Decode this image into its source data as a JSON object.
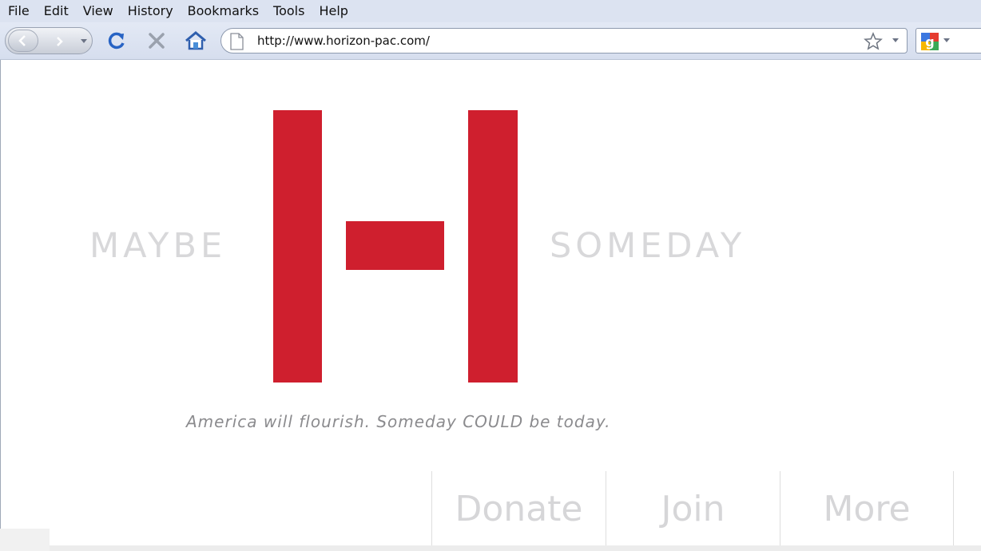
{
  "menubar": {
    "items": [
      {
        "label": "File"
      },
      {
        "label": "Edit"
      },
      {
        "label": "View"
      },
      {
        "label": "History"
      },
      {
        "label": "Bookmarks"
      },
      {
        "label": "Tools"
      },
      {
        "label": "Help"
      }
    ]
  },
  "toolbar": {
    "url": "http://www.horizon-pac.com/",
    "icons": [
      "back-icon",
      "forward-icon",
      "reload-icon",
      "stop-icon",
      "home-icon",
      "page-icon",
      "star-icon",
      "google-icon"
    ]
  },
  "hero": {
    "left_word": "MAYBE",
    "right_word": "SOMEDAY",
    "tagline": "America will flourish. Someday COULD be today."
  },
  "nav": {
    "donate": "Donate",
    "join": "Join",
    "more": "More"
  },
  "colors": {
    "brand_red": "#cf1f2e",
    "faded_text": "#d8d8da",
    "chrome": "#dce3f1"
  }
}
